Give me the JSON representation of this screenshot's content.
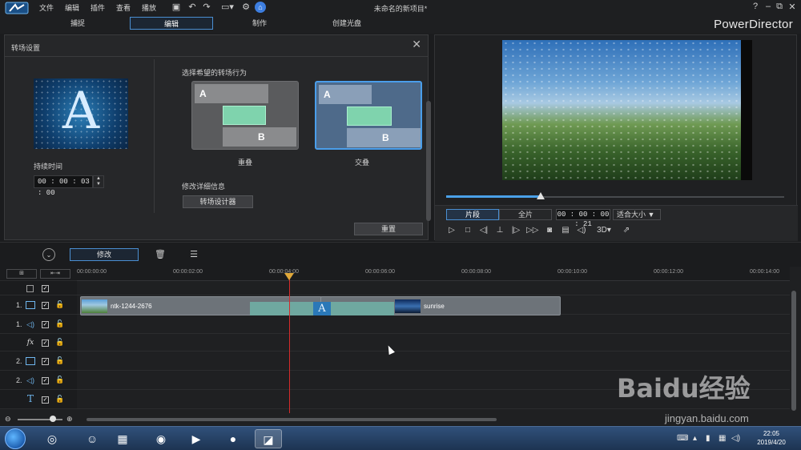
{
  "titlebar": {
    "menus": [
      "文件",
      "编辑",
      "插件",
      "查看",
      "播放"
    ],
    "window_title": "未命名的新项目*",
    "help": "?"
  },
  "modes": {
    "tabs": [
      "捕捉",
      "编辑",
      "制作",
      "创建光盘"
    ],
    "active": "编辑",
    "brand": "PowerDirector"
  },
  "settings": {
    "title": "转场设置",
    "duration_label": "持续时间",
    "duration_value": "00 : 00 : 03 : 00",
    "behavior_heading": "选择希望的转场行为",
    "cards": [
      {
        "label": "重叠",
        "a": "A",
        "b": "B"
      },
      {
        "label": "交叠",
        "a": "A",
        "b": "B"
      }
    ],
    "detail_label": "修改详细信息",
    "designer_button": "转场设计器",
    "reset_button": "重置"
  },
  "preview": {
    "clip_tab": "片段",
    "full_tab": "全片",
    "timecode": "00 : 00 : 00 : 21",
    "fit": "适合大小",
    "mode_3d": "3D",
    "progress": 0.28
  },
  "timeline_toolbar": {
    "modify_button": "修改"
  },
  "timeline": {
    "ticks": [
      "00:00:00:00",
      "00:00:02:00",
      "00:00:04:00",
      "00:00:06:00",
      "00:00:08:00",
      "00:00:10:00",
      "00:00:12:00",
      "00:00:14:00"
    ],
    "tracks": [
      {
        "num": "1.",
        "icon": "video"
      },
      {
        "num": "1.",
        "icon": "audio"
      },
      {
        "num": "",
        "icon": "fx"
      },
      {
        "num": "2.",
        "icon": "video"
      },
      {
        "num": "2.",
        "icon": "audio"
      },
      {
        "num": "",
        "icon": "text"
      }
    ],
    "clips": [
      {
        "name": "ntk-1244-2676"
      },
      {
        "name": "sunrise"
      }
    ],
    "transition_letter": "A"
  },
  "taskbar": {
    "time": "22:05",
    "date": "2019/4/20"
  },
  "watermark": {
    "brand": "Baidu经验",
    "url": "jingyan.baidu.com"
  }
}
